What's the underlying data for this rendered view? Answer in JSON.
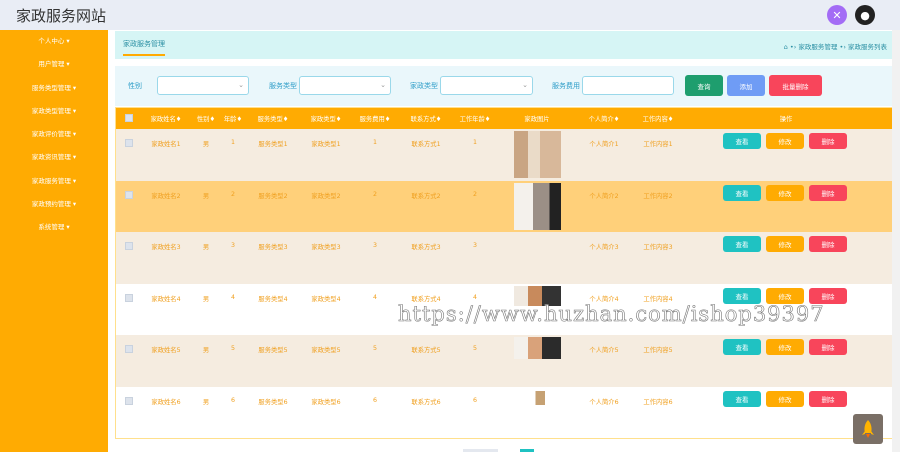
{
  "app": {
    "title": "家政服务网站"
  },
  "sidebar": {
    "items": [
      "个人中心",
      "用户管理",
      "服务类型管理",
      "家政类型管理",
      "家政评价管理",
      "家政资讯管理",
      "家政服务管理",
      "家政预约管理",
      "系统管理"
    ]
  },
  "breadcrumb": {
    "tab": "家政服务管理",
    "path": "⌂ •› 家政服务管理 •› 家政服务列表"
  },
  "search": {
    "gender_label": "性别",
    "service_type_label": "服务类型",
    "housekeeping_type_label": "家政类型",
    "fee_label": "服务费用",
    "query_button": "查询",
    "add_button": "添加",
    "batch_delete_button": "批量删除"
  },
  "table": {
    "headers": [
      "家政姓名♦",
      "性别♦",
      "年龄♦",
      "服务类型♦",
      "家政类型♦",
      "服务费用♦",
      "联系方式♦",
      "工作年龄♦",
      "家政图片",
      "个人简介♦",
      "工作内容♦",
      "操作"
    ],
    "rows": [
      [
        "家政姓名1",
        "男",
        "1",
        "服务类型1",
        "家政类型1",
        "1",
        "联系方式1",
        "1",
        "个人简介1",
        "工作内容1"
      ],
      [
        "家政姓名2",
        "男",
        "2",
        "服务类型2",
        "家政类型2",
        "2",
        "联系方式2",
        "2",
        "个人简介2",
        "工作内容2"
      ],
      [
        "家政姓名3",
        "男",
        "3",
        "服务类型3",
        "家政类型3",
        "3",
        "联系方式3",
        "3",
        "个人简介3",
        "工作内容3"
      ],
      [
        "家政姓名4",
        "男",
        "4",
        "服务类型4",
        "家政类型4",
        "4",
        "联系方式4",
        "4",
        "个人简介4",
        "工作内容4"
      ],
      [
        "家政姓名5",
        "男",
        "5",
        "服务类型5",
        "家政类型5",
        "5",
        "联系方式5",
        "5",
        "个人简介5",
        "工作内容5"
      ],
      [
        "家政姓名6",
        "男",
        "6",
        "服务类型6",
        "家政类型6",
        "6",
        "联系方式6",
        "6",
        "个人简介6",
        "工作内容6"
      ]
    ],
    "row_colors": [
      "#f5ece0",
      "#ffd07a",
      "#f5ece0",
      "#ffffff",
      "#f5ece0",
      "#ffffff"
    ],
    "actions": {
      "view": "查看",
      "edit": "修改",
      "delete": "删除"
    }
  },
  "watermark": "https://www.huzhan.com/ishop39397",
  "colors": {
    "accent": "#ffab02",
    "view": "#1fc2c2",
    "edit": "#ffab02",
    "delete": "#f8455b",
    "query": "#1e9e6e",
    "add": "#6f9cf5"
  }
}
